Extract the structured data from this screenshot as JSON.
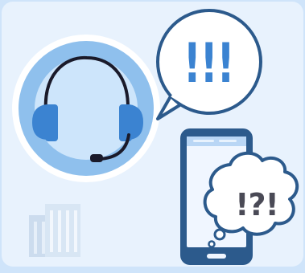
{
  "scene": {
    "speech_bubble_text": "!!!",
    "thought_bubble_text": "!?!",
    "icons": [
      "headset-icon",
      "smartphone-icon",
      "building-icon"
    ],
    "colors": {
      "background": "#cfe4fa",
      "panel": "#e8f2fd",
      "accent": "#3b83d1",
      "outline": "#2c5a8c"
    }
  }
}
